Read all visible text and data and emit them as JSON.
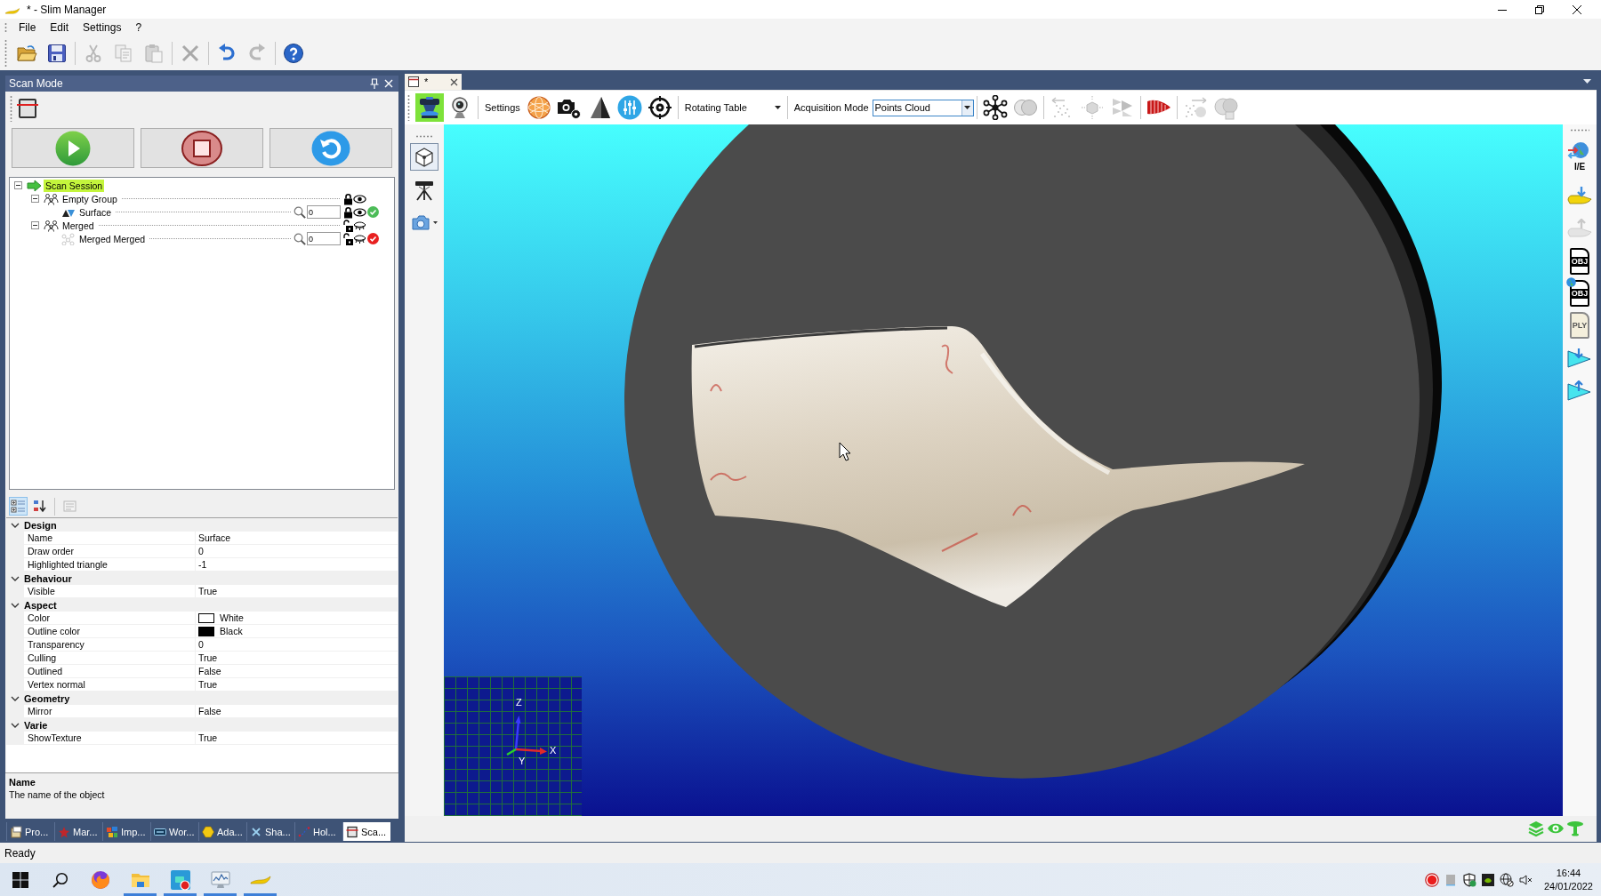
{
  "window": {
    "title": "* - Slim Manager"
  },
  "menu": [
    "File",
    "Edit",
    "Settings",
    "?"
  ],
  "toolbar": [
    {
      "tools": [
        {
          "kind": "open",
          "disabled": false
        },
        {
          "kind": "save",
          "disabled": false
        }
      ]
    },
    {
      "tools": [
        {
          "kind": "cut",
          "disabled": true
        },
        {
          "kind": "copy",
          "disabled": true
        },
        {
          "kind": "paste",
          "disabled": true
        }
      ]
    },
    {
      "tools": [
        {
          "kind": "delete",
          "disabled": true
        }
      ]
    },
    {
      "tools": [
        {
          "kind": "undo",
          "disabled": false
        },
        {
          "kind": "redo",
          "disabled": true
        }
      ]
    },
    {
      "tools": [
        {
          "kind": "help",
          "disabled": false
        }
      ]
    }
  ],
  "scan_panel": {
    "title": "Scan Mode",
    "tree": [
      {
        "label": "Scan Session",
        "kind": "session",
        "selected": true,
        "expanded": true,
        "children": [
          {
            "label": "Empty Group",
            "kind": "group",
            "selected": false,
            "expanded": true,
            "locked": true,
            "visible": true,
            "children": [
              {
                "label": "Surface",
                "kind": "surface",
                "selected": false,
                "filter": "0",
                "locked": true,
                "visible": true,
                "color": "#4cbc58"
              }
            ]
          },
          {
            "label": "Merged",
            "kind": "group",
            "selected": false,
            "expanded": true,
            "locked": false,
            "visible": false,
            "children": [
              {
                "label": "Merged Merged",
                "kind": "merged",
                "selected": false,
                "filter": "0",
                "locked": false,
                "visible": false,
                "color": "#e82020"
              }
            ]
          }
        ]
      }
    ],
    "property_views": [
      {
        "kind": "categorized",
        "selected": true,
        "disabled": false
      },
      {
        "kind": "alphabetical",
        "selected": false,
        "disabled": false
      },
      {
        "kind": "property_pages",
        "selected": false,
        "disabled": true
      }
    ],
    "properties": [
      {
        "title": "Design",
        "expanded": true,
        "rows": [
          {
            "name": "Name",
            "value": "Surface"
          },
          {
            "name": "Draw order",
            "value": "0"
          },
          {
            "name": "Highlighted triangle",
            "value": "-1"
          }
        ]
      },
      {
        "title": "Behaviour",
        "expanded": true,
        "rows": [
          {
            "name": "Visible",
            "value": "True"
          }
        ]
      },
      {
        "title": "Aspect",
        "expanded": true,
        "rows": [
          {
            "name": "Color",
            "value": "White",
            "color": "#ffffff"
          },
          {
            "name": "Outline color",
            "value": "Black",
            "color": "#000000"
          },
          {
            "name": "Transparency",
            "value": "0"
          },
          {
            "name": "Culling",
            "value": "True"
          },
          {
            "name": "Outlined",
            "value": "False"
          },
          {
            "name": "Vertex normal",
            "value": "True"
          }
        ]
      },
      {
        "title": "Geometry",
        "expanded": true,
        "rows": [
          {
            "name": "Mirror",
            "value": "False"
          }
        ]
      },
      {
        "title": "Varie",
        "expanded": true,
        "rows": [
          {
            "name": "ShowTexture",
            "value": "True"
          }
        ]
      }
    ],
    "description": {
      "title": "Name",
      "text": "The name of the object"
    }
  },
  "panel_tabs": [
    {
      "kind": "project",
      "label": "Pro...",
      "selected": false
    },
    {
      "kind": "marker",
      "label": "Mar...",
      "selected": false
    },
    {
      "kind": "import",
      "label": "Imp...",
      "selected": false
    },
    {
      "kind": "workspace",
      "label": "Wor...",
      "selected": false
    },
    {
      "kind": "adapt",
      "label": "Ada...",
      "selected": false
    },
    {
      "kind": "shape",
      "label": "Sha...",
      "selected": false
    },
    {
      "kind": "holes",
      "label": "Hol...",
      "selected": false
    },
    {
      "kind": "scan",
      "label": "Sca...",
      "selected": true
    }
  ],
  "document": {
    "tab": {
      "label": "*"
    },
    "scan_tools": [
      {
        "kind": "scanner",
        "selected": true
      },
      {
        "kind": "webcam",
        "selected": false
      }
    ],
    "settings": {
      "label": "Settings",
      "tools": [
        {
          "kind": "sphere"
        },
        {
          "kind": "camera_settings"
        },
        {
          "kind": "triangle"
        },
        {
          "kind": "equalizer"
        },
        {
          "kind": "target"
        }
      ]
    },
    "turntable": {
      "value": "Rotating Table"
    },
    "acquisition": {
      "label": "Acquisition Mode",
      "value": "Points Cloud"
    },
    "cloud_tools": [
      {
        "tools": [
          {
            "kind": "network",
            "disabled": false
          },
          {
            "kind": "overlap",
            "disabled": true
          }
        ]
      },
      {
        "tools": [
          {
            "kind": "align",
            "disabled": true
          },
          {
            "kind": "cube",
            "disabled": true
          },
          {
            "kind": "merge",
            "disabled": true
          }
        ]
      },
      {
        "tools": [
          {
            "kind": "wave",
            "disabled": false
          }
        ]
      },
      {
        "tools": [
          {
            "kind": "align_back",
            "disabled": true
          },
          {
            "kind": "spheres",
            "disabled": true
          }
        ]
      }
    ],
    "view_tools": [
      {
        "kind": "cube_view",
        "selected": true
      },
      {
        "kind": "tripod",
        "selected": false
      },
      {
        "kind": "camera_menu",
        "selected": false
      }
    ],
    "axes": {
      "z": "Z",
      "x": "X",
      "y": "Y"
    },
    "side_tools": [
      {
        "kind": "import_export",
        "label": "I/E",
        "disabled": false
      },
      {
        "kind": "shoe_import",
        "disabled": false
      },
      {
        "kind": "shoe_export",
        "disabled": true
      },
      {
        "kind": "file",
        "label": "OBJ",
        "disabled": false
      },
      {
        "kind": "file_web",
        "label": "OBJ",
        "disabled": false
      },
      {
        "kind": "file_doc",
        "label": "PLY",
        "disabled": false
      },
      {
        "kind": "mesh_import",
        "disabled": false
      },
      {
        "kind": "mesh_export",
        "disabled": false
      }
    ],
    "view_toggles": [
      {
        "kind": "layers",
        "on": true
      },
      {
        "kind": "eye",
        "on": true
      },
      {
        "kind": "tripod",
        "on": true
      }
    ]
  },
  "status_bar": {
    "text": "Ready"
  },
  "taskbar": {
    "apps": [
      {
        "kind": "firefox",
        "running": false
      },
      {
        "kind": "explorer",
        "running": true
      },
      {
        "kind": "recorder",
        "running": true
      },
      {
        "kind": "monitor",
        "running": true
      },
      {
        "kind": "slim",
        "running": true
      }
    ],
    "tray": [
      {
        "kind": "record"
      },
      {
        "kind": "stop"
      },
      {
        "kind": "shield"
      },
      {
        "kind": "gpu"
      },
      {
        "kind": "network"
      },
      {
        "kind": "mute"
      }
    ],
    "time": "16:44",
    "date": "24/01/2022"
  }
}
